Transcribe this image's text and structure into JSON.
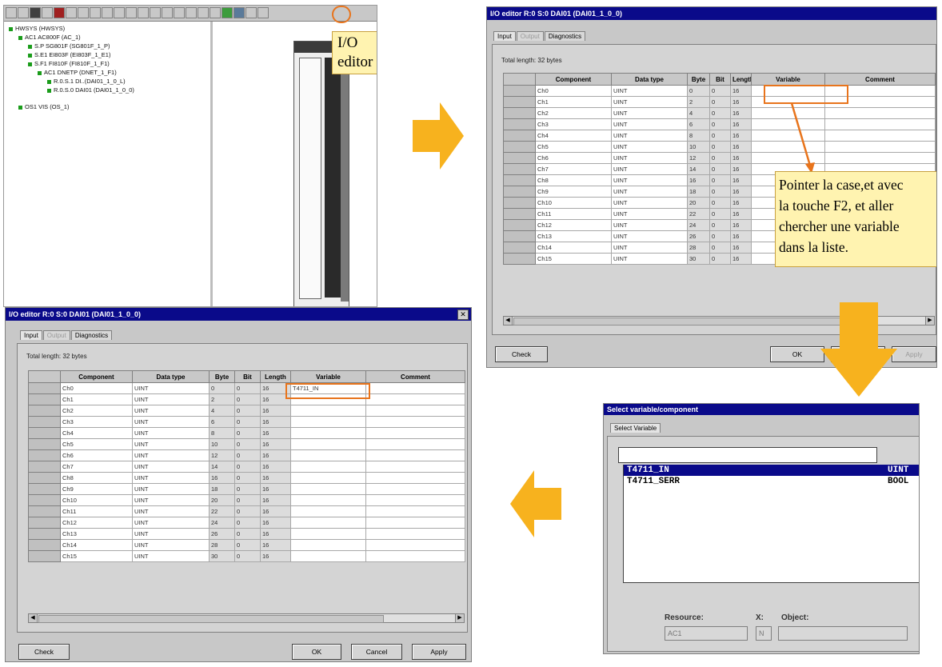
{
  "hw_tree": {
    "items": [
      {
        "label": "HWSYS (HWSYS)",
        "indent": 0
      },
      {
        "label": "AC1  AC800F (AC_1)",
        "indent": 1
      },
      {
        "label": "S.P  SG801F (SG801F_1_P)",
        "indent": 2
      },
      {
        "label": "S.E1  EI803F (EI803F_1_E1)",
        "indent": 2
      },
      {
        "label": "S.F1  FI810F (FI810F_1_F1)",
        "indent": 2
      },
      {
        "label": "AC1  DNETP (DNET_1_F1)",
        "indent": 3
      },
      {
        "label": "R.0.S.1  DI..(DAI01_1_0_L)",
        "indent": 4
      },
      {
        "label": "R.0.S.0  DAI01 (DAI01_1_0_0)",
        "indent": 4
      },
      {
        "label": "OS1  VIS (OS_1)",
        "indent": 1
      }
    ],
    "callout": "I/O editor"
  },
  "dialog1": {
    "title": "I/O editor  R:0 S:0  DAI01  (DAI01_1_0_0)",
    "tabs": [
      "Input",
      "Output",
      "Diagnostics"
    ],
    "total": "Total length:  32 bytes",
    "headers": [
      "Component",
      "Data type",
      "Byte",
      "Bit",
      "Length",
      "Variable",
      "Comment"
    ],
    "rows": [
      [
        "Ch0",
        "UINT",
        "0",
        "0",
        "16",
        "",
        ""
      ],
      [
        "Ch1",
        "UINT",
        "2",
        "0",
        "16",
        "",
        ""
      ],
      [
        "Ch2",
        "UINT",
        "4",
        "0",
        "16",
        "",
        ""
      ],
      [
        "Ch3",
        "UINT",
        "6",
        "0",
        "16",
        "",
        ""
      ],
      [
        "Ch4",
        "UINT",
        "8",
        "0",
        "16",
        "",
        ""
      ],
      [
        "Ch5",
        "UINT",
        "10",
        "0",
        "16",
        "",
        ""
      ],
      [
        "Ch6",
        "UINT",
        "12",
        "0",
        "16",
        "",
        ""
      ],
      [
        "Ch7",
        "UINT",
        "14",
        "0",
        "16",
        "",
        ""
      ],
      [
        "Ch8",
        "UINT",
        "16",
        "0",
        "16",
        "",
        ""
      ],
      [
        "Ch9",
        "UINT",
        "18",
        "0",
        "16",
        "",
        ""
      ],
      [
        "Ch10",
        "UINT",
        "20",
        "0",
        "16",
        "",
        ""
      ],
      [
        "Ch11",
        "UINT",
        "22",
        "0",
        "16",
        "",
        ""
      ],
      [
        "Ch12",
        "UINT",
        "24",
        "0",
        "16",
        "",
        ""
      ],
      [
        "Ch13",
        "UINT",
        "26",
        "0",
        "16",
        "",
        ""
      ],
      [
        "Ch14",
        "UINT",
        "28",
        "0",
        "16",
        "",
        ""
      ],
      [
        "Ch15",
        "UINT",
        "30",
        "0",
        "16",
        "",
        ""
      ]
    ],
    "btn_check": "Check",
    "btn_ok": "OK",
    "btn_apply": "Apply",
    "callout_lines": [
      "Pointer la case,et avec",
      "la touche F2, et aller",
      "chercher une variable",
      "dans la liste."
    ]
  },
  "dialog2": {
    "title": "I/O editor  R:0 S:0  DAI01  (DAI01_1_0_0)",
    "tabs": [
      "Input",
      "Output",
      "Diagnostics"
    ],
    "total": "Total length:  32 bytes",
    "headers": [
      "Component",
      "Data type",
      "Byte",
      "Bit",
      "Length",
      "Variable",
      "Comment"
    ],
    "rows": [
      [
        "Ch0",
        "UINT",
        "0",
        "0",
        "16",
        "T4711_IN",
        ""
      ],
      [
        "Ch1",
        "UINT",
        "2",
        "0",
        "16",
        "",
        ""
      ],
      [
        "Ch2",
        "UINT",
        "4",
        "0",
        "16",
        "",
        ""
      ],
      [
        "Ch3",
        "UINT",
        "6",
        "0",
        "16",
        "",
        ""
      ],
      [
        "Ch4",
        "UINT",
        "8",
        "0",
        "16",
        "",
        ""
      ],
      [
        "Ch5",
        "UINT",
        "10",
        "0",
        "16",
        "",
        ""
      ],
      [
        "Ch6",
        "UINT",
        "12",
        "0",
        "16",
        "",
        ""
      ],
      [
        "Ch7",
        "UINT",
        "14",
        "0",
        "16",
        "",
        ""
      ],
      [
        "Ch8",
        "UINT",
        "16",
        "0",
        "16",
        "",
        ""
      ],
      [
        "Ch9",
        "UINT",
        "18",
        "0",
        "16",
        "",
        ""
      ],
      [
        "Ch10",
        "UINT",
        "20",
        "0",
        "16",
        "",
        ""
      ],
      [
        "Ch11",
        "UINT",
        "22",
        "0",
        "16",
        "",
        ""
      ],
      [
        "Ch12",
        "UINT",
        "24",
        "0",
        "16",
        "",
        ""
      ],
      [
        "Ch13",
        "UINT",
        "26",
        "0",
        "16",
        "",
        ""
      ],
      [
        "Ch14",
        "UINT",
        "28",
        "0",
        "16",
        "",
        ""
      ],
      [
        "Ch15",
        "UINT",
        "30",
        "0",
        "16",
        "",
        ""
      ]
    ],
    "btn_check": "Check",
    "btn_ok": "OK",
    "btn_cancel": "Cancel",
    "btn_apply": "Apply"
  },
  "select_var": {
    "title": "Select variable/component",
    "tab": "Select Variable",
    "items": [
      {
        "name": "T4711_IN",
        "type": "UINT",
        "selected": true
      },
      {
        "name": "T4711_SERR",
        "type": "BOOL",
        "selected": false
      }
    ],
    "resource_label": "Resource:",
    "resource_value": "AC1",
    "x_label": "X:",
    "x_value": "N",
    "object_label": "Object:"
  },
  "colors": {
    "arrow": "#f7b21e",
    "highlight": "#e8741c",
    "titlebar": "#0a0a8a",
    "callout_bg": "#fff3b0"
  }
}
